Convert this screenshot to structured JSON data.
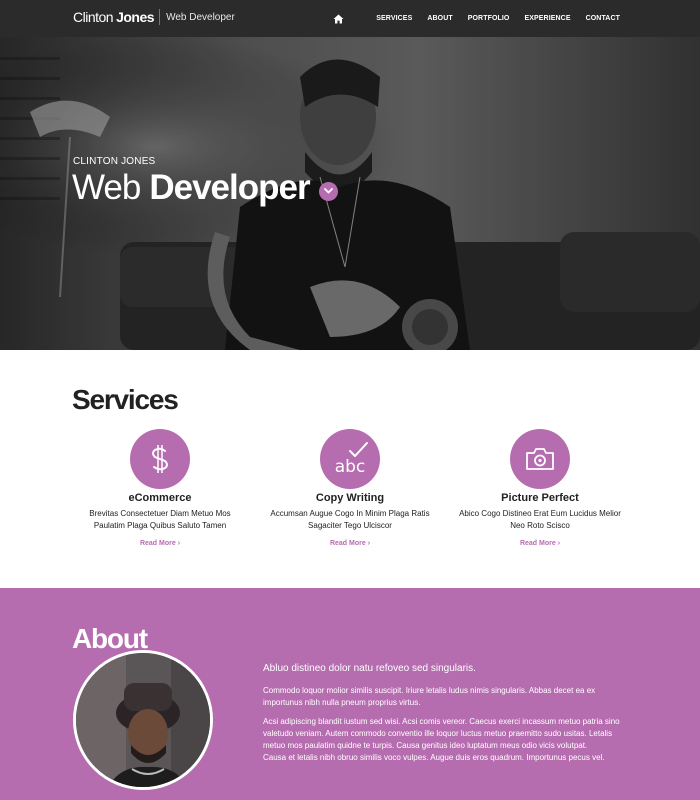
{
  "brand": {
    "first": "Clinton",
    "last": "Jones",
    "tagline": "Web Developer"
  },
  "nav": {
    "home_icon": "home-icon",
    "links": [
      "SERVICES",
      "ABOUT",
      "PORTFOLIO",
      "EXPERIENCE",
      "CONTACT"
    ]
  },
  "hero": {
    "eyebrow": "CLINTON JONES",
    "title_light": "Web",
    "title_bold": "Developer",
    "scroll_icon": "chevron-down-icon"
  },
  "services": {
    "title": "Services",
    "items": [
      {
        "icon": "dollar-icon",
        "title": "eCommerce",
        "desc": "Brevitas Consectetuer Diam Metuo Mos Paulatim Plaga Quibus Saluto Tamen",
        "more": "Read More"
      },
      {
        "icon": "abc-check-icon",
        "title": "Copy Writing",
        "desc": "Accumsan Augue Cogo In Minim Plaga Ratis Sagaciter Tego Ulciscor",
        "more": "Read More"
      },
      {
        "icon": "camera-icon",
        "title": "Picture Perfect",
        "desc": "Abico Cogo Distineo Erat Eum Lucidus Melior Neo Roto Scisco",
        "more": "Read More"
      }
    ]
  },
  "about": {
    "title": "About",
    "lead": "Abluo distineo dolor natu refoveo sed singularis.",
    "p1": "Commodo loquor molior similis suscipit. Iriure letalis ludus nimis singularis. Abbas decet ea ex importunus nibh nulla pneum proprius virtus.",
    "p2": "Acsi adipiscing blandit iustum sed wisi. Acsi comis vereor. Caecus exerci incassum metuo patria sino valetudo veniam. Autem commodo conventio ille loquor luctus metuo praemitto sudo usitas. Letalis metuo mos paulatim quidne te turpis. Causa genitus ideo luptatum meus odio vicis volutpat.",
    "p3": "Causa et letalis nibh obruo similis voco vulpes. Augue duis eros quadrum. Importunus pecus vel."
  },
  "colors": {
    "accent": "#b66db0",
    "navbar": "#2b2b2c"
  }
}
